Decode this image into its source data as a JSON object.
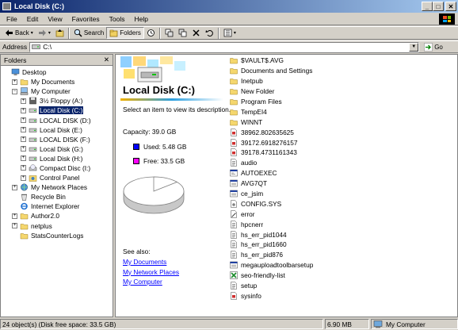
{
  "window": {
    "title": "Local Disk (C:)",
    "controls": [
      "_",
      "□",
      "✕"
    ]
  },
  "menu": [
    "File",
    "Edit",
    "View",
    "Favorites",
    "Tools",
    "Help"
  ],
  "toolbar": {
    "back": "Back",
    "search": "Search",
    "folders": "Folders"
  },
  "address": {
    "label": "Address",
    "value": "C:\\",
    "go": "Go"
  },
  "folders_panel": {
    "title": "Folders",
    "close": "✕",
    "tree": [
      {
        "label": "Desktop",
        "depth": 0,
        "expander": "",
        "icon": "desktop-icon"
      },
      {
        "label": "My Documents",
        "depth": 1,
        "expander": "+",
        "icon": "folder-icon"
      },
      {
        "label": "My Computer",
        "depth": 1,
        "expander": "−",
        "icon": "computer-icon"
      },
      {
        "label": "3½ Floppy (A:)",
        "depth": 2,
        "expander": "+",
        "icon": "floppy-icon"
      },
      {
        "label": "Local Disk (C:)",
        "depth": 2,
        "expander": "+",
        "icon": "drive-icon",
        "selected": true
      },
      {
        "label": "LOCAL DISK (D:)",
        "depth": 2,
        "expander": "+",
        "icon": "drive-icon"
      },
      {
        "label": "Local Disk (E:)",
        "depth": 2,
        "expander": "+",
        "icon": "drive-icon"
      },
      {
        "label": "LOCAL DISK (F:)",
        "depth": 2,
        "expander": "+",
        "icon": "drive-icon"
      },
      {
        "label": "Local Disk (G:)",
        "depth": 2,
        "expander": "+",
        "icon": "drive-icon"
      },
      {
        "label": "Local Disk (H:)",
        "depth": 2,
        "expander": "+",
        "icon": "drive-icon"
      },
      {
        "label": "Compact Disc (I:)",
        "depth": 2,
        "expander": "+",
        "icon": "cd-icon"
      },
      {
        "label": "Control Panel",
        "depth": 2,
        "expander": "+",
        "icon": "control-panel-icon"
      },
      {
        "label": "My Network Places",
        "depth": 1,
        "expander": "+",
        "icon": "network-icon"
      },
      {
        "label": "Recycle Bin",
        "depth": 1,
        "expander": "",
        "icon": "recycle-bin-icon"
      },
      {
        "label": "Internet Explorer",
        "depth": 1,
        "expander": "",
        "icon": "ie-icon"
      },
      {
        "label": "Author2.0",
        "depth": 1,
        "expander": "+",
        "icon": "folder-icon"
      },
      {
        "label": "netplus",
        "depth": 1,
        "expander": "+",
        "icon": "folder-icon"
      },
      {
        "label": "StatsCounterLogs",
        "depth": 1,
        "expander": "",
        "icon": "folder-icon"
      }
    ]
  },
  "details": {
    "title": "Local Disk (C:)",
    "hint": "Select an item to view its description.",
    "capacity": "Capacity: 39.0 GB",
    "used": "Used: 5.48 GB",
    "free": "Free: 33.5 GB",
    "used_fraction": 0.14,
    "colors": {
      "used": "#0000ff",
      "free": "#ff00ff",
      "pie_face": "#ffffff",
      "pie_edge": "#808080"
    },
    "see_also": "See also:",
    "links": [
      "My Documents",
      "My Network Places",
      "My Computer"
    ]
  },
  "files": [
    {
      "name": "$VAULT$.AVG",
      "icon": "folder-icon"
    },
    {
      "name": "Documents and Settings",
      "icon": "folder-icon"
    },
    {
      "name": "Inetpub",
      "icon": "folder-icon"
    },
    {
      "name": "New Folder",
      "icon": "folder-icon"
    },
    {
      "name": "Program Files",
      "icon": "folder-icon"
    },
    {
      "name": "TempEI4",
      "icon": "folder-icon"
    },
    {
      "name": "WINNT",
      "icon": "folder-icon"
    },
    {
      "name": "38962.802635625",
      "icon": "log-file-icon"
    },
    {
      "name": "39172.6918276157",
      "icon": "log-file-icon"
    },
    {
      "name": "39178.4731161343",
      "icon": "log-file-icon"
    },
    {
      "name": "audio",
      "icon": "text-file-icon"
    },
    {
      "name": "AUTOEXEC",
      "icon": "batch-file-icon"
    },
    {
      "name": "AVG7QT",
      "icon": "exe-file-icon"
    },
    {
      "name": "ce_jsim",
      "icon": "exe-file-icon"
    },
    {
      "name": "CONFIG.SYS",
      "icon": "sys-file-icon"
    },
    {
      "name": "error",
      "icon": "settings-file-icon"
    },
    {
      "name": "hpcnerr",
      "icon": "text-file-icon"
    },
    {
      "name": "hs_err_pid1044",
      "icon": "text-file-icon"
    },
    {
      "name": "hs_err_pid1660",
      "icon": "text-file-icon"
    },
    {
      "name": "hs_err_pid876",
      "icon": "text-file-icon"
    },
    {
      "name": "megauploadtoolbarsetup",
      "icon": "exe-file-icon"
    },
    {
      "name": "seo-friendly-list",
      "icon": "excel-file-icon"
    },
    {
      "name": "setup",
      "icon": "text-file-icon"
    },
    {
      "name": "sysinfo",
      "icon": "log-file-icon"
    }
  ],
  "status": {
    "objects": "24 object(s) (Disk free space: 33.5 GB)",
    "size": "6.90 MB",
    "zone": "My Computer"
  }
}
